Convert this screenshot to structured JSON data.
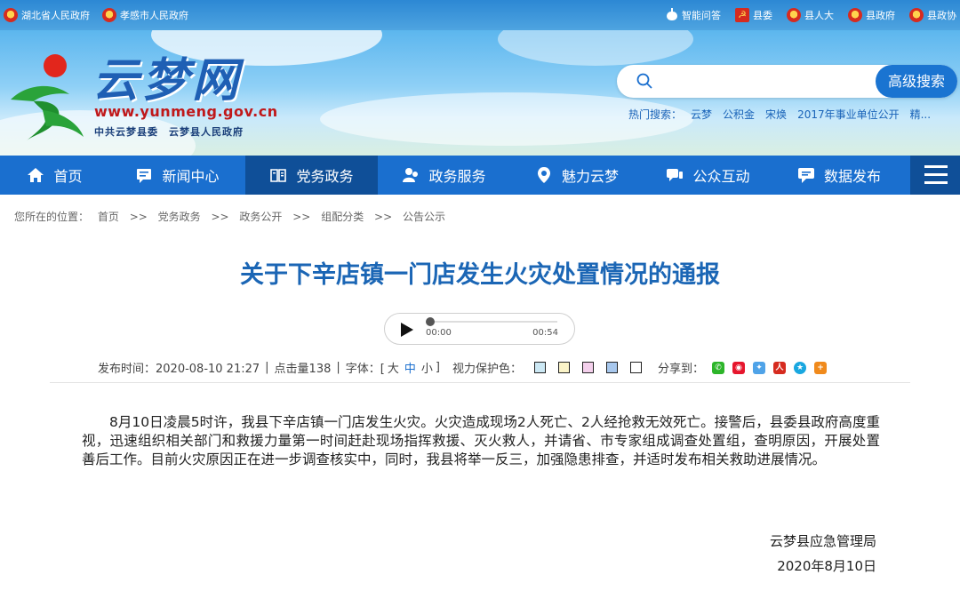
{
  "topbar": {
    "left_links": [
      "湖北省人民政府",
      "孝感市人民政府"
    ],
    "right_links": [
      {
        "label": "智能问答",
        "icon": "robot-icon"
      },
      {
        "label": "县委",
        "icon": "party-emblem-icon"
      },
      {
        "label": "县人大",
        "icon": "national-emblem-icon"
      },
      {
        "label": "县政府",
        "icon": "national-emblem-icon"
      },
      {
        "label": "县政协",
        "icon": "cppcc-emblem-icon"
      }
    ]
  },
  "banner": {
    "site_name": "云梦网",
    "url": "www.yunmeng.gov.cn",
    "subtitle": "中共云梦县委　云梦县人民政府"
  },
  "search": {
    "placeholder": "",
    "button_label": "高级搜索",
    "hot_label": "热门搜索：",
    "hot_terms": [
      "云梦",
      "公积金",
      "宋焕",
      "2017年事业单位公开",
      "精..."
    ]
  },
  "nav": {
    "items": [
      {
        "label": "首页",
        "icon": "home-icon",
        "active": false
      },
      {
        "label": "新闻中心",
        "icon": "news-icon",
        "active": false
      },
      {
        "label": "党务政务",
        "icon": "book-icon",
        "active": true
      },
      {
        "label": "政务服务",
        "icon": "service-icon",
        "active": false
      },
      {
        "label": "魅力云梦",
        "icon": "location-pin-icon",
        "active": false
      },
      {
        "label": "公众互动",
        "icon": "chat-icon",
        "active": false
      },
      {
        "label": "数据发布",
        "icon": "data-chat-icon",
        "active": false
      }
    ],
    "menu_icon": "hamburger-menu-icon"
  },
  "breadcrumb": {
    "label": "您所在的位置：",
    "items": [
      "首页",
      "党务政务",
      "政务公开",
      "组配分类",
      "公告公示"
    ],
    "separator": ">>"
  },
  "article": {
    "title": "关于下辛店镇一门店发生火灾处置情况的通报",
    "audio": {
      "current": "00:00",
      "duration": "00:54",
      "progress": 0
    },
    "meta": {
      "publish": "发布时间：2020-08-10 21:27",
      "sep": "|",
      "clicks": "点击量138",
      "font_label": "字体：[",
      "font_large": "大",
      "font_mid": "中",
      "font_small": "小",
      "font_end": "]",
      "eye_label": "视力保护色：",
      "eye_colors": [
        "#cce8f4",
        "#fbf4c8",
        "#f4d0ec",
        "#a8c8ee",
        "#ffffff"
      ],
      "share_label": "分享到："
    },
    "body": "8月10日凌晨5时许，我县下辛店镇一门店发生火灾。火灾造成现场2人死亡、2人经抢救无效死亡。接警后，县委县政府高度重视，迅速组织相关部门和救援力量第一时间赶赴现场指挥救援、灭火救人，并请省、市专家组成调查处置组，查明原因，开展处置善后工作。目前火灾原因正在进一步调查核实中，同时，我县将举一反三，加强隐患排查，并适时发布相关救助进展情况。",
    "signature": "云梦县应急管理局",
    "date": "2020年8月10日"
  }
}
